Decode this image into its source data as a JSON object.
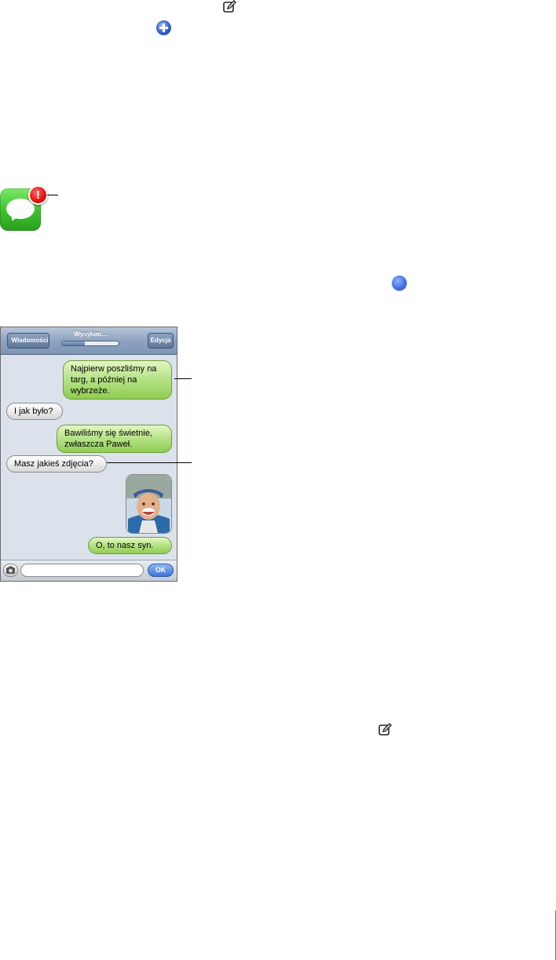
{
  "icons": {
    "compose_top": "compose-icon",
    "add_contact": "plus-icon",
    "compose_bottom": "compose-icon",
    "app": "messages-app-icon",
    "badge_text": "!",
    "blue_dot": "blue-dot-icon"
  },
  "colors": {
    "badge": "#e10f0f",
    "app_green": "#3cc12c",
    "outgoing_bubble": "#a6da6b",
    "incoming_bubble": "#e8e8e8",
    "nav_bar": "#8ea3c0",
    "blue_dot": "#3d6de0",
    "page_rule": "#2e7dbf"
  },
  "phone": {
    "nav": {
      "back_label": "Wiadomości",
      "title": "Wysyłam....",
      "progress": 0.4,
      "edit_label": "Edycja"
    },
    "messages": [
      {
        "dir": "out",
        "text": "Najpierw poszliśmy na targ, a później na wybrzeże."
      },
      {
        "dir": "in",
        "text": "I jak było?"
      },
      {
        "dir": "out",
        "text": "Bawiliśmy się świetnie, zwłaszcza Paweł."
      },
      {
        "dir": "in",
        "text": "Masz jakieś zdjęcia?"
      },
      {
        "dir": "out",
        "type": "photo"
      },
      {
        "dir": "out",
        "text": "O, to nasz syn."
      }
    ],
    "input": {
      "placeholder": "",
      "send_label": "OK"
    }
  }
}
